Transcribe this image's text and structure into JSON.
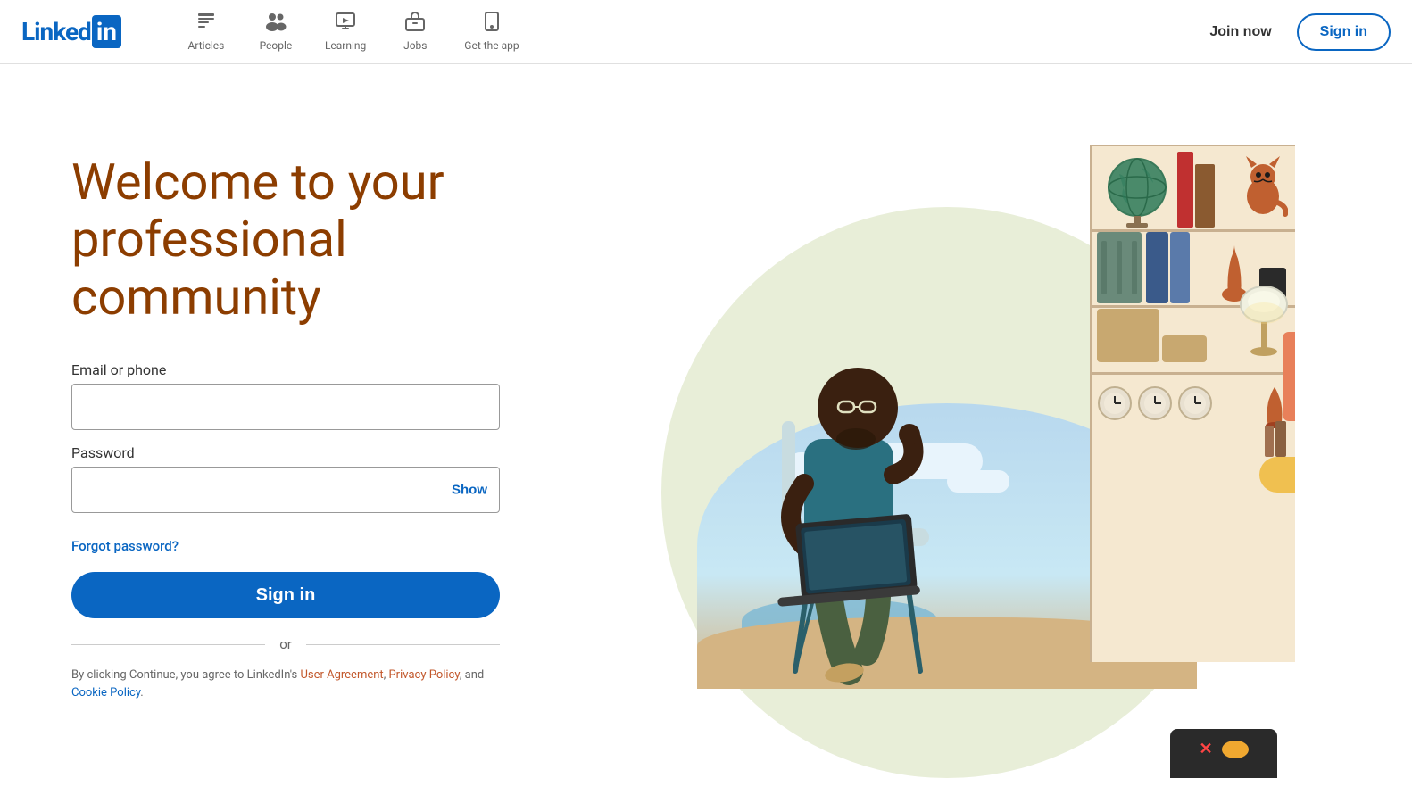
{
  "header": {
    "logo_text": "Linked",
    "logo_box": "in",
    "nav_items": [
      {
        "id": "articles",
        "label": "Articles",
        "icon": "▦"
      },
      {
        "id": "people",
        "label": "People",
        "icon": "👥"
      },
      {
        "id": "learning",
        "label": "Learning",
        "icon": "▶"
      },
      {
        "id": "jobs",
        "label": "Jobs",
        "icon": "💼"
      },
      {
        "id": "get-app",
        "label": "Get the app",
        "icon": "💻"
      }
    ],
    "join_label": "Join now",
    "signin_label": "Sign in"
  },
  "hero": {
    "title_line1": "Welcome to your",
    "title_line2": "professional community"
  },
  "form": {
    "email_label": "Email or phone",
    "email_placeholder": "",
    "password_label": "Password",
    "password_placeholder": "",
    "show_label": "Show",
    "forgot_label": "Forgot password?",
    "signin_button": "Sign in",
    "or_text": "or"
  },
  "legal": {
    "prefix": "By clicking Continue, you agree to LinkedIn's ",
    "user_agreement": "User Agreement",
    "comma": ", ",
    "privacy_policy": "Privacy Policy",
    "and": ", and ",
    "cookie_policy": "Cookie Policy",
    "period": "."
  }
}
